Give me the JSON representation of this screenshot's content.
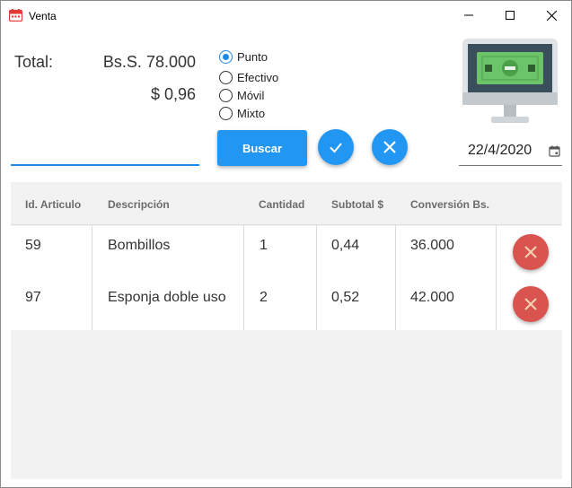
{
  "window": {
    "title": "Venta",
    "icon": "calendar-app-icon",
    "controls": [
      "minimize-icon",
      "maximize-icon",
      "close-icon"
    ]
  },
  "totals": {
    "label": "Total:",
    "bolivares": "Bs.S. 78.000",
    "dolares": "$ 0,96"
  },
  "search": {
    "value": "",
    "placeholder": ""
  },
  "payment_methods": [
    {
      "label": "Punto",
      "checked": true
    },
    {
      "label": "Efectivo",
      "checked": false
    },
    {
      "label": "Móvil",
      "checked": false
    },
    {
      "label": "Mixto",
      "checked": false
    }
  ],
  "actions": {
    "search_label": "Buscar",
    "confirm_icon": "check-icon",
    "cancel_icon": "x-icon"
  },
  "date": {
    "value": "22/4/2020",
    "icon": "calendar-icon"
  },
  "table": {
    "columns": [
      "Id. Articulo",
      "Descripción",
      "Cantidad",
      "Subtotal $",
      "Conversión Bs."
    ],
    "rows": [
      {
        "id": "59",
        "descripcion": "Bombillos",
        "cantidad": "1",
        "subtotal": "0,44",
        "conversion": "36.000"
      },
      {
        "id": "97",
        "descripcion": "Esponja doble uso",
        "cantidad": "2",
        "subtotal": "0,52",
        "conversion": "42.000"
      }
    ],
    "row_action_icon": "delete-x-icon"
  },
  "colors": {
    "accent": "#2196f3",
    "danger": "#d9534f"
  }
}
